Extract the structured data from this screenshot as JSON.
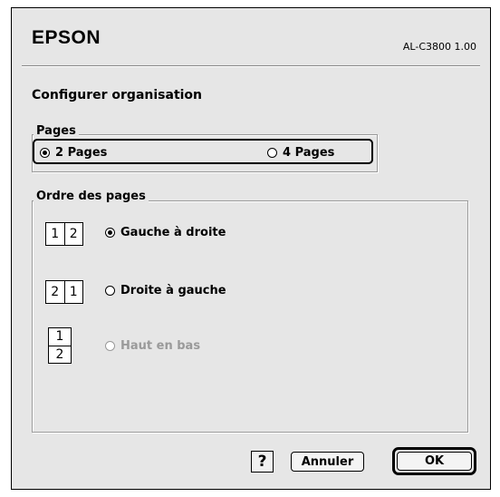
{
  "header": {
    "brand": "EPSON",
    "model": "AL-C3800 1.00"
  },
  "title": "Configurer organisation",
  "pages_group": {
    "label": "Pages",
    "options": [
      {
        "label": "2 Pages",
        "selected": true
      },
      {
        "label": "4 Pages",
        "selected": false
      }
    ]
  },
  "order_group": {
    "label": "Ordre des pages",
    "options": [
      {
        "label": "Gauche à droite",
        "selected": true,
        "enabled": true,
        "icon": [
          "1",
          "2"
        ]
      },
      {
        "label": "Droite à gauche",
        "selected": false,
        "enabled": true,
        "icon": [
          "2",
          "1"
        ]
      },
      {
        "label": "Haut en bas",
        "selected": false,
        "enabled": false,
        "icon": [
          "1",
          "2"
        ]
      }
    ]
  },
  "footer": {
    "help_label": "?",
    "cancel_label": "Annuler",
    "ok_label": "OK"
  }
}
